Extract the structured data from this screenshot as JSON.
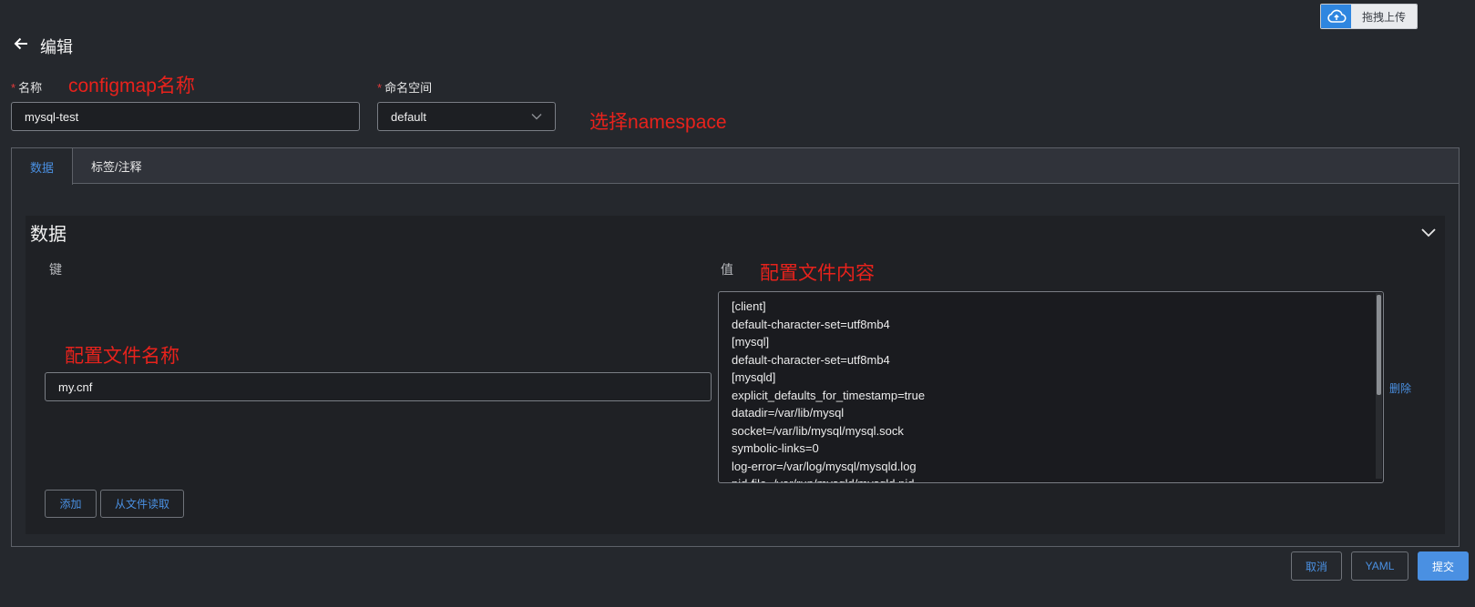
{
  "upload": {
    "label": "拖拽上传",
    "icon": "cloud-upload-icon"
  },
  "header": {
    "title": "编辑",
    "back_icon": "arrow-left-icon"
  },
  "form": {
    "name": {
      "required_mark": "*",
      "label": "名称",
      "value": "mysql-test"
    },
    "namespace": {
      "required_mark": "*",
      "label": "命名空间",
      "value": "default",
      "icon": "chevron-down-icon"
    }
  },
  "annotations": {
    "name": "configmap名称",
    "namespace": "选择namespace",
    "value": "配置文件内容",
    "key": "配置文件名称"
  },
  "tabs": [
    {
      "label": "数据",
      "active": true
    },
    {
      "label": "标签/注释",
      "active": false
    }
  ],
  "data_section": {
    "title": "数据",
    "key_label": "键",
    "value_label": "值",
    "key_value": "my.cnf",
    "value_lines": [
      "[client]",
      "default-character-set=utf8mb4",
      "[mysql]",
      "default-character-set=utf8mb4",
      "[mysqld]",
      "explicit_defaults_for_timestamp=true",
      "datadir=/var/lib/mysql",
      "socket=/var/lib/mysql/mysql.sock",
      "symbolic-links=0",
      "log-error=/var/log/mysql/mysqld.log",
      "pid-file=/var/run/mysqld/mysqld.pid"
    ],
    "delete_label": "删除",
    "add_label": "添加",
    "read_file_label": "从文件读取"
  },
  "footer": {
    "cancel_label": "取消",
    "yaml_label": "YAML",
    "submit_label": "提交"
  },
  "colors": {
    "accent": "#4a90e2",
    "annotation": "#e8221c",
    "required": "#e23b3b",
    "background": "#25282d"
  }
}
